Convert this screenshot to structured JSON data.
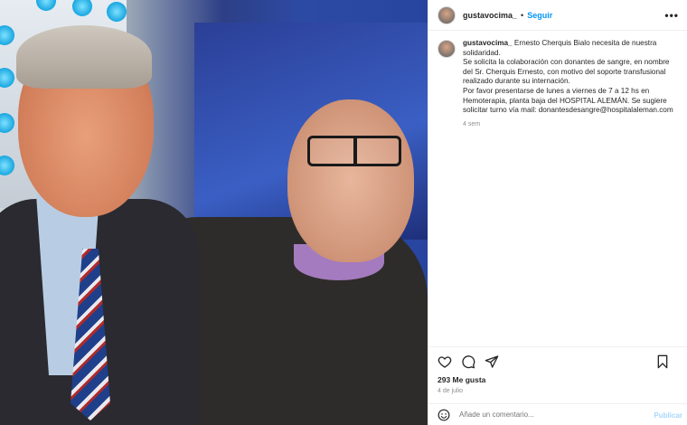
{
  "post": {
    "username": "gustavocima_",
    "separator": "•",
    "follow_label": "Seguir",
    "more_label": "•••",
    "caption_lines": [
      "Ernesto Cherquis Bialo necesita de nuestra",
      "solidaridad.",
      "Se solicita la colaboración con donantes de sangre, en nombre",
      "del Sr. Cherquis Ernesto, con motivo del soporte transfusional",
      "realizado durante su internación.",
      "Por favor presentarse de lunes a viernes de 7 a 12 hs en",
      "Hemoterapia, planta baja del HOSPITAL ALEMÁN. Se sugiere",
      "solicitar turno vía mail: donantesdesangre@hospitalaleman.com"
    ],
    "caption_time": "4 sem",
    "likes": "293 Me gusta",
    "date": "4 de julio"
  },
  "comment": {
    "placeholder": "Añade un comentario...",
    "publish_label": "Publicar"
  },
  "icons": {
    "like": "heart-icon",
    "comment": "comment-icon",
    "share": "share-icon",
    "save": "bookmark-icon",
    "emoji": "emoji-icon"
  }
}
